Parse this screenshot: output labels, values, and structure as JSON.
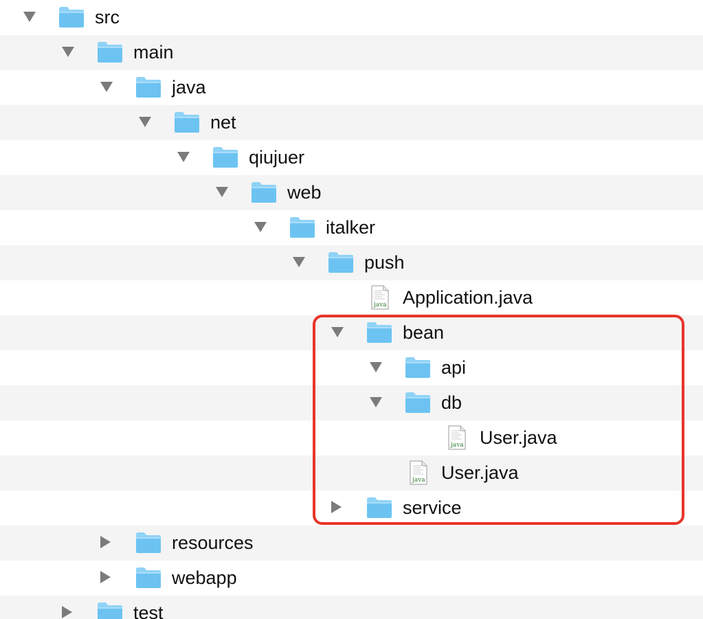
{
  "tree": [
    {
      "label": "src",
      "kind": "folder",
      "disclosure": "open",
      "depth": 0
    },
    {
      "label": "main",
      "kind": "folder",
      "disclosure": "open",
      "depth": 1
    },
    {
      "label": "java",
      "kind": "folder",
      "disclosure": "open",
      "depth": 2
    },
    {
      "label": "net",
      "kind": "folder",
      "disclosure": "open",
      "depth": 3
    },
    {
      "label": "qiujuer",
      "kind": "folder",
      "disclosure": "open",
      "depth": 4
    },
    {
      "label": "web",
      "kind": "folder",
      "disclosure": "open",
      "depth": 5
    },
    {
      "label": "italker",
      "kind": "folder",
      "disclosure": "open",
      "depth": 6
    },
    {
      "label": "push",
      "kind": "folder",
      "disclosure": "open",
      "depth": 7
    },
    {
      "label": "Application.java",
      "kind": "java-file",
      "disclosure": "none",
      "depth": 8
    },
    {
      "label": "bean",
      "kind": "folder",
      "disclosure": "open",
      "depth": 8
    },
    {
      "label": "api",
      "kind": "folder",
      "disclosure": "open",
      "depth": 9
    },
    {
      "label": "db",
      "kind": "folder",
      "disclosure": "open",
      "depth": 9
    },
    {
      "label": "User.java",
      "kind": "java-file",
      "disclosure": "none",
      "depth": 10
    },
    {
      "label": "User.java",
      "kind": "java-file",
      "disclosure": "none",
      "depth": 9
    },
    {
      "label": "service",
      "kind": "folder",
      "disclosure": "closed",
      "depth": 8
    },
    {
      "label": "resources",
      "kind": "folder",
      "disclosure": "closed",
      "depth": 2
    },
    {
      "label": "webapp",
      "kind": "folder",
      "disclosure": "closed",
      "depth": 2
    },
    {
      "label": "test",
      "kind": "folder",
      "disclosure": "closed",
      "depth": 1
    }
  ],
  "icons": {
    "folder": "folder-icon",
    "java-file": "java-file-icon",
    "open": "disclosure-triangle-open-icon",
    "closed": "disclosure-triangle-closed-icon"
  },
  "colors": {
    "folder_body": "#6cc3f2",
    "folder_tab": "#8fd3f7",
    "row_stripe": "#f4f4f4",
    "highlight_border": "#e8352a",
    "disclosure": "#7b7b7b"
  },
  "file_icon_text": "java"
}
